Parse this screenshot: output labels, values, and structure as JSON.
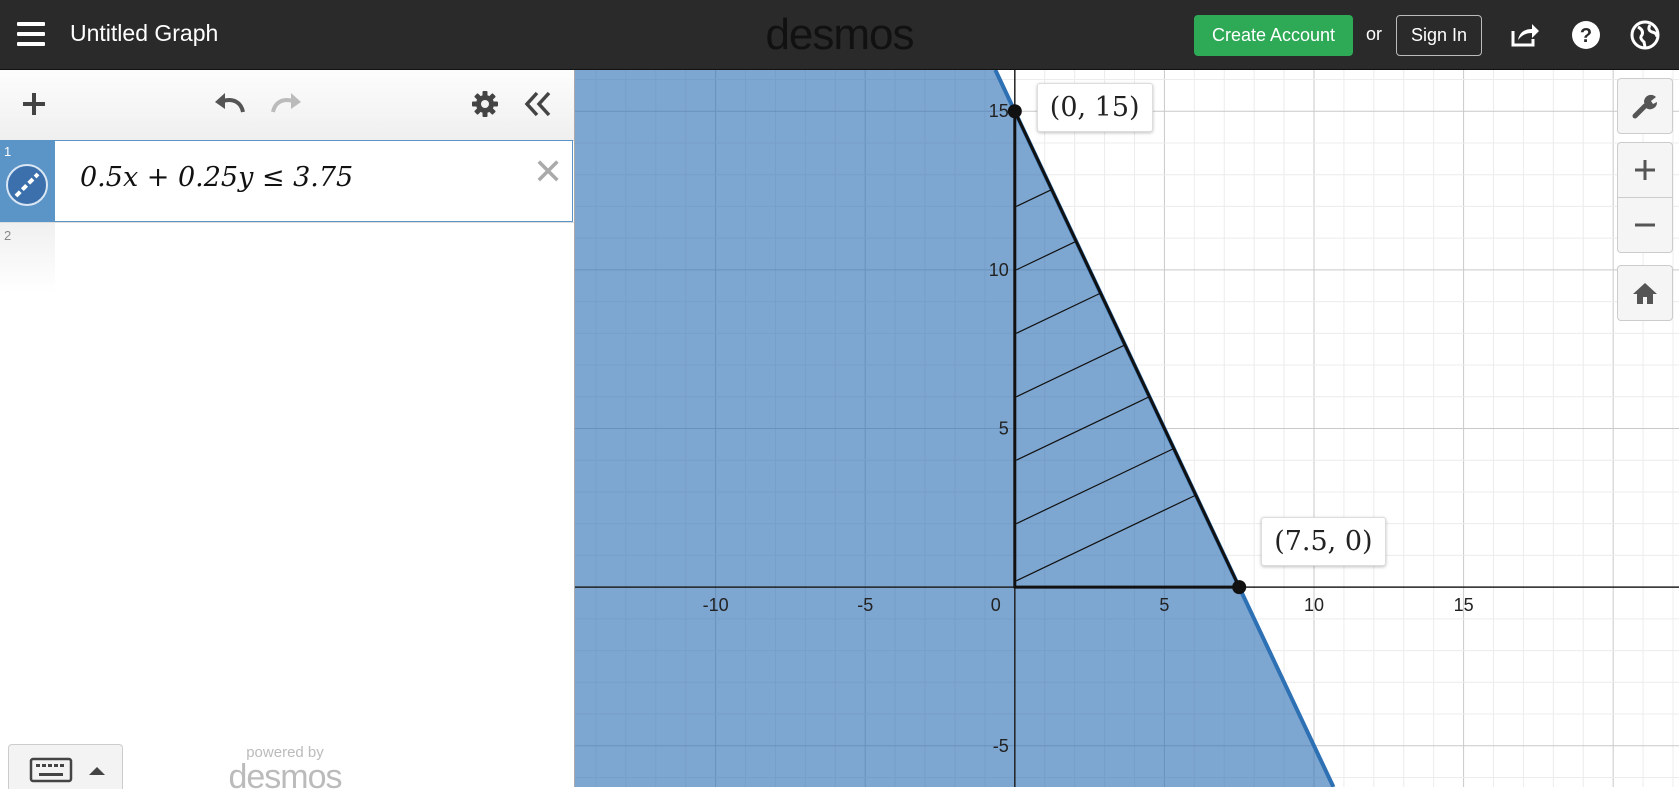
{
  "header": {
    "menu_icon": "hamburger-icon",
    "title": "Untitled Graph",
    "logo": "desmos",
    "create_account": "Create Account",
    "or": "or",
    "sign_in": "Sign In",
    "icons": [
      "share-icon",
      "help-icon",
      "language-globe-icon"
    ]
  },
  "toolbar": {
    "icons": [
      "add-icon",
      "undo-icon",
      "redo-icon",
      "settings-gear-icon",
      "collapse-panel-icon"
    ]
  },
  "expressions": [
    {
      "number": "1",
      "latex": "0.5x + 0.25y ≤ 3.75",
      "color": "#2d70b3"
    },
    {
      "number": "2",
      "latex": ""
    }
  ],
  "footer": {
    "keyboard_icon": "keyboard-icon",
    "powered_by": "powered by",
    "powered_logo": "desmos"
  },
  "graph_tools": [
    "wrench-icon",
    "zoom-in-icon",
    "zoom-out-icon",
    "home-icon"
  ],
  "chart_data": {
    "type": "scatter",
    "x_ticks": [
      "-10",
      "-5",
      "0",
      "5",
      "10",
      "15"
    ],
    "y_ticks": [
      "15",
      "10",
      "5",
      "-5"
    ],
    "xlim": [
      -14.7,
      22.2
    ],
    "ylim": [
      -6.3,
      16.3
    ],
    "grid": true,
    "inequality": {
      "boundary_points": [
        [
          0,
          15
        ],
        [
          7.5,
          0
        ]
      ],
      "shaded": "below",
      "color": "#2d70b3"
    },
    "points": [
      {
        "x": 0,
        "y": 15,
        "label": "(0, 15)"
      },
      {
        "x": 7.5,
        "y": 0,
        "label": "(7.5, 0)"
      }
    ],
    "feasible_region": [
      [
        0,
        15
      ],
      [
        0,
        0
      ],
      [
        7.5,
        0
      ]
    ]
  }
}
